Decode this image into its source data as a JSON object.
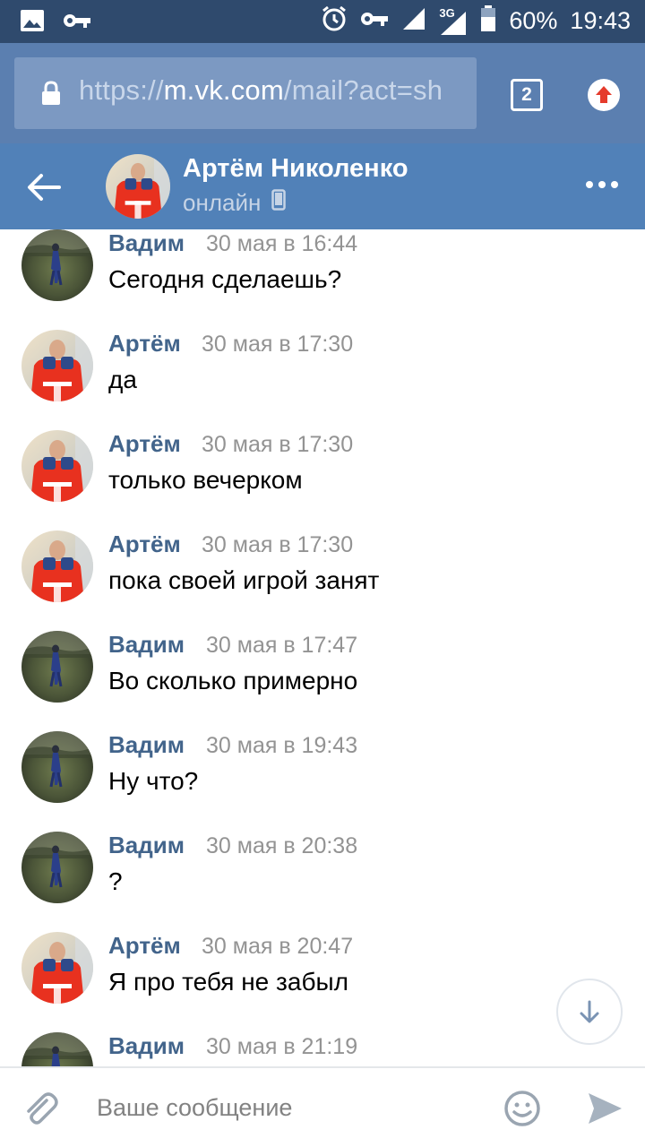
{
  "status_bar": {
    "battery": "60%",
    "time": "19:43",
    "network": "3G",
    "icons": [
      "image-icon",
      "key-icon",
      "alarm-icon",
      "key-icon",
      "signal-icon",
      "battery-icon"
    ]
  },
  "browser": {
    "url_scheme": "https://",
    "url_host": "m.vk.com",
    "url_path": "/mail?act=sh",
    "tabs_count": "2"
  },
  "header": {
    "name": "Артём Николенко",
    "status": "онлайн"
  },
  "messages": [
    {
      "sender": "Вадим",
      "time": "30 мая в 16:44",
      "text": "Сегодня сделаешь?",
      "avatar": "vadim"
    },
    {
      "sender": "Артём",
      "time": "30 мая в 17:30",
      "text": "да",
      "avatar": "artem"
    },
    {
      "sender": "Артём",
      "time": "30 мая в 17:30",
      "text": "только вечерком",
      "avatar": "artem"
    },
    {
      "sender": "Артём",
      "time": "30 мая в 17:30",
      "text": "пока своей игрой занят",
      "avatar": "artem"
    },
    {
      "sender": "Вадим",
      "time": "30 мая в 17:47",
      "text": "Во сколько примерно",
      "avatar": "vadim"
    },
    {
      "sender": "Вадим",
      "time": "30 мая в 19:43",
      "text": "Ну что?",
      "avatar": "vadim"
    },
    {
      "sender": "Вадим",
      "time": "30 мая в 20:38",
      "text": "?",
      "avatar": "vadim"
    },
    {
      "sender": "Артём",
      "time": "30 мая в 20:47",
      "text": "Я про тебя не забыл",
      "avatar": "artem"
    },
    {
      "sender": "Вадим",
      "time": "30 мая в 21:19",
      "text": "",
      "avatar": "vadim"
    }
  ],
  "composer": {
    "placeholder": "Ваше сообщение"
  },
  "colors": {
    "status_bar": "#2f4a6d",
    "browser_bar": "#5b7fb0",
    "header": "#5181b8",
    "sender_name": "#42648b",
    "timestamp": "#939393"
  }
}
